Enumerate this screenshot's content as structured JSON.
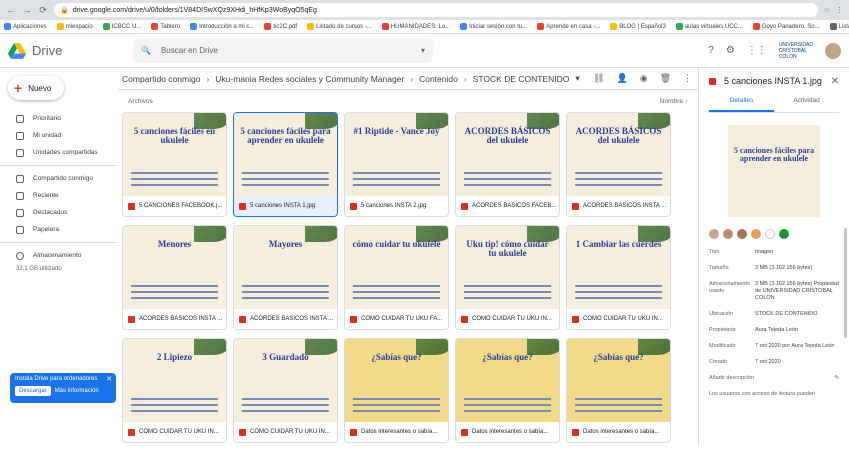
{
  "browser": {
    "url": "drive.google.com/drive/u/0/folders/1V84DISwXQz9XHdi_hHfKp3WoByqO5qEg",
    "bookmarks": [
      "Aplicaciones",
      "miespacio",
      "ICBCC U...",
      "Tablero",
      "Introducción a mi c...",
      "tic2C.pdf",
      "Listado de cursos -...",
      "HUMANIDADES: Lo...",
      "Iniciar sesión con tu...",
      "Aprende en casa -...",
      "BLOG | Español3",
      "aulas virtuales UCC...",
      "Goyo Panadero. So...",
      "Lista de le"
    ]
  },
  "app": {
    "name": "Drive",
    "search_placeholder": "Buscar en Drive",
    "uni_line1": "UNIVERSIDAD",
    "uni_line2": "CRISTOBAL",
    "uni_line3": "COLON"
  },
  "sidebar": {
    "new_label": "Nuevo",
    "items": [
      "Prioritario",
      "Mi unidad",
      "Unidades compartidas",
      "Compartido conmigo",
      "Reciente",
      "Destacados",
      "Papelera"
    ],
    "storage_label": "Almacenamiento",
    "storage_used": "32,1 GB utilizado"
  },
  "install_banner": {
    "text": "Instala Drive para ordenadores",
    "download": "Descargar",
    "more": "Más información"
  },
  "breadcrumb": {
    "items": [
      "Compartido conmigo",
      "Uku-mania Redes sociales y Community Manager",
      "Contenido",
      "STOCK DE CONTENIDO"
    ]
  },
  "list": {
    "section": "Archivos",
    "sort": "Nombre"
  },
  "files": [
    {
      "name": "5 CANCIONES FACEBOOK.j...",
      "thumb": "5 canciones fáciles en ukulele",
      "style": "cream"
    },
    {
      "name": "5 canciones INSTA 1.jpg",
      "thumb": "5 canciones fáciles para aprender en ukulele",
      "style": "cream",
      "selected": true
    },
    {
      "name": "5 canciones INSTA 2.jpg",
      "thumb": "#1 Riptide - Vance Joy",
      "style": "cream"
    },
    {
      "name": "ACORDES BASICOS FACEB...",
      "thumb": "ACORDES BÁSICOS del ukulele",
      "style": "cream"
    },
    {
      "name": "ACORDES BASICOS INSTA ...",
      "thumb": "ACORDES BÁSICOS del ukulele",
      "style": "cream"
    },
    {
      "name": "ACORDES BASICOS INSTA ...",
      "thumb": "Menores",
      "style": "cream"
    },
    {
      "name": "ACORDES BASICOS INSTA ...",
      "thumb": "Mayores",
      "style": "cream"
    },
    {
      "name": "COMO CUIDAR TU UKU FA...",
      "thumb": "cómo cuidar tu ukulele",
      "style": "cream"
    },
    {
      "name": "COMO CUIDAR TU UKU IN...",
      "thumb": "Uku tip! cómo cuidar tu ukulele",
      "style": "cream"
    },
    {
      "name": "COMO CUIDAR TU UKU IN...",
      "thumb": "1 Cambiar las cuerdes",
      "style": "cream"
    },
    {
      "name": "COMO CUIDAR TU UKU IN...",
      "thumb": "2 Lipiezo",
      "style": "cream"
    },
    {
      "name": "COMO CUIDAR TU UKU IN...",
      "thumb": "3 Guardado",
      "style": "cream"
    },
    {
      "name": "Datos interesantes o sabía...",
      "thumb": "¿Sabías que?",
      "style": "yellow"
    },
    {
      "name": "Datos interesantes o sabía...",
      "thumb": "¿Sabías que?",
      "style": "yellow"
    },
    {
      "name": "Datos interesantes o sabía...",
      "thumb": "¿Sabías que?",
      "style": "yellow"
    }
  ],
  "details": {
    "title": "5 canciones INSTA 1.jpg",
    "tab_details": "Detalles",
    "tab_activity": "Actividad",
    "preview_text": "5 canciones fáciles para aprender en ukulele",
    "props": [
      {
        "label": "Tipo",
        "value": "Imagen"
      },
      {
        "label": "Tamaño",
        "value": "3 MB (3.162.156 bytes)"
      },
      {
        "label": "Almacenamiento usado",
        "value": "3 MB (3.162.156 bytes) Propiedad de UNIVERSIDAD CRISTOBAL COLON"
      },
      {
        "label": "Ubicación",
        "value": "STOCK DE CONTENIDO"
      },
      {
        "label": "Propietario",
        "value": "Aura Tejeda León"
      },
      {
        "label": "Modificado",
        "value": "7 oct 2020 por Aura Tejeda León"
      },
      {
        "label": "Creado",
        "value": "7 oct 2020"
      }
    ],
    "add_desc": "Añadir descripción",
    "footer": "Los usuarios con acceso de lectura pueden"
  }
}
